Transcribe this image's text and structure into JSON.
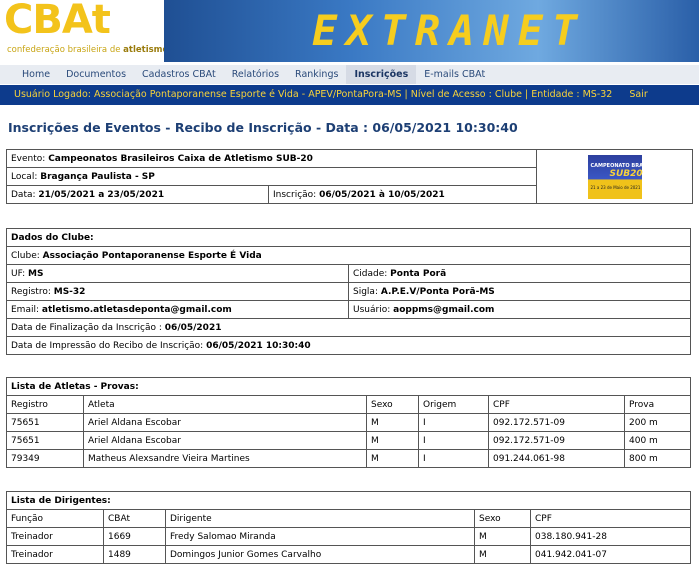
{
  "header": {
    "logo_text": "CBAt",
    "logo_sub_prefix": "confederação brasileira de ",
    "logo_sub_bold": "atletismo",
    "banner_text": "EXTRANET"
  },
  "nav": {
    "items": [
      "Home",
      "Documentos",
      "Cadastros CBAt",
      "Relatórios",
      "Rankings",
      "Inscrições",
      "E-mails CBAt"
    ],
    "active": "Inscrições"
  },
  "userbar": {
    "text": "Usuário Logado: Associação Pontaporanense Esporte é Vida - APEV/PontaPora-MS | Nível de Acesso : Clube | Entidade : MS-32",
    "exit": "Sair"
  },
  "page_title": "Inscrições de Eventos - Recibo de Inscrição - Data : 06/05/2021 10:30:40",
  "event": {
    "event_label": "Evento:",
    "event_value": "Campeonatos Brasileiros Caixa de Atletismo SUB-20",
    "local_label": "Local:",
    "local_value": "Bragança Paulista - SP",
    "date_label": "Data:",
    "date_value": "21/05/2021 a 23/05/2021",
    "insc_label": "Inscrição:",
    "insc_value": "06/05/2021 à 10/05/2021",
    "thumb_line1": "CAMPEONATO BRASILEIRO",
    "thumb_line2": "SUB20",
    "thumb_line3": "21 a 23 de Maio de 2021"
  },
  "club": {
    "section_title": "Dados do Clube:",
    "clube_label": "Clube:",
    "clube_value": "Associação Pontaporanense Esporte É Vida",
    "uf_label": "UF:",
    "uf_value": "MS",
    "cidade_label": "Cidade:",
    "cidade_value": "Ponta Porã",
    "registro_label": "Registro:",
    "registro_value": "MS-32",
    "sigla_label": "Sigla:",
    "sigla_value": "A.P.E.V/Ponta Porã-MS",
    "email_label": "Email:",
    "email_value": "atletismo.atletasdeponta@gmail.com",
    "usuario_label": "Usuário:",
    "usuario_value": "aoppms@gmail.com",
    "finalizacao_label": "Data de Finalização da Inscrição :",
    "finalizacao_value": "06/05/2021",
    "impressao_label": "Data de Impressão do Recibo de Inscrição:",
    "impressao_value": "06/05/2021 10:30:40"
  },
  "athletes": {
    "section_title": "Lista de Atletas - Provas:",
    "headers": [
      "Registro",
      "Atleta",
      "Sexo",
      "Origem",
      "CPF",
      "Prova"
    ],
    "rows": [
      [
        "75651",
        "Ariel Aldana Escobar",
        "M",
        "I",
        "092.172.571-09",
        "200 m"
      ],
      [
        "75651",
        "Ariel Aldana Escobar",
        "M",
        "I",
        "092.172.571-09",
        "400 m"
      ],
      [
        "79349",
        "Matheus Alexsandre Vieira Martines",
        "M",
        "I",
        "091.244.061-98",
        "800 m"
      ]
    ]
  },
  "directors": {
    "section_title": "Lista de Dirigentes:",
    "headers": [
      "Função",
      "CBAt",
      "Dirigente",
      "Sexo",
      "CPF"
    ],
    "rows": [
      [
        "Treinador",
        "1669",
        "Fredy Salomao Miranda",
        "M",
        "038.180.941-28"
      ],
      [
        "Treinador",
        "1489",
        "Domingos Junior Gomes Carvalho",
        "M",
        "041.942.041-07"
      ]
    ]
  },
  "colors": {
    "userbar_bg": "#0d3b8c",
    "userbar_text": "#f8d33a",
    "title": "#1d3f74",
    "banner_text": "#f6cd1e"
  }
}
